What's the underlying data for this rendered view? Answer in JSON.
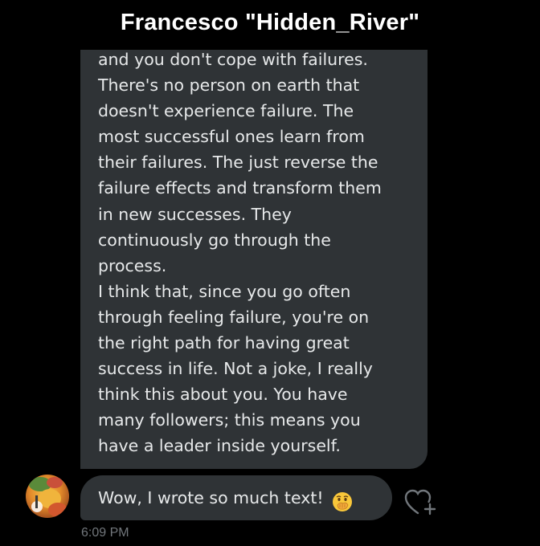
{
  "header": {
    "title": "Francesco \"Hidden_River\""
  },
  "conversation": {
    "long_message": "and you don't cope with failures.\nThere's no person on earth that\ndoesn't experience failure. The\nmost successful ones learn from\ntheir failures. The just reverse the\nfailure effects and transform them\nin new successes. They\ncontinuously go through the\nprocess.\nI think that, since you go often\nthrough feeling failure, you're on\nthe right path for having great\nsuccess in life. Not a joke, I really\nthink this about you. You have\nmany followers; this means you\nhave a leader inside yourself.",
    "short_message": "Wow, I wrote so much text!",
    "short_message_emoji": "face-with-hand-over-mouth-emoji",
    "timestamp": "6:09 PM"
  },
  "icons": {
    "avatar": "user-avatar",
    "react": "add-reaction-heart-icon"
  },
  "colors": {
    "background": "#000000",
    "bubble": "#2f3336",
    "text": "#e7e9ea",
    "muted": "#71767b"
  }
}
